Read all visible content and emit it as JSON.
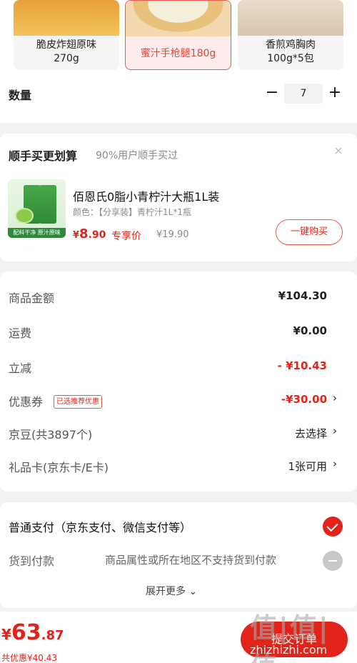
{
  "variants": [
    {
      "name_line1": "脆皮炸翅原味",
      "name_line2": "270g",
      "selected": false
    },
    {
      "name_line1": "蜜汁手枪腿180g",
      "name_line2": "",
      "selected": true
    },
    {
      "name_line1": "香煎鸡胸肉",
      "name_line2": "100g*5包",
      "selected": false
    }
  ],
  "quantity": {
    "label": "数量",
    "minus": "−",
    "value": "7",
    "plus": "+"
  },
  "addon": {
    "title": "顺手买更划算",
    "subtitle": "90%用户顺手买过",
    "close": "×",
    "image_tag": "配料干净 原汁原味",
    "name": "佰恩氏0脂小青柠汁大瓶1L装",
    "spec": "颜色：【分享装】青柠汁1L*1瓶",
    "price_symbol": "¥",
    "price_int": "8",
    "price_dec": ".90",
    "price_tag": "专享价",
    "original_price": "¥19.90",
    "buy_button": "一键购买"
  },
  "summary": {
    "rows": [
      {
        "label": "商品金额",
        "value": "¥104.30"
      },
      {
        "label": "运费",
        "value": "¥0.00"
      },
      {
        "label": "立减",
        "value": "- ¥10.43"
      },
      {
        "label": "优惠券",
        "badge": "已选推荐优惠",
        "value": "-¥30.00",
        "arrow": "›"
      },
      {
        "label": "京豆(共3897个)",
        "value": "去选择",
        "arrow": "›"
      },
      {
        "label": "礼品卡(京东卡/E卡)",
        "value": "1张可用",
        "arrow": "›"
      }
    ]
  },
  "payment": {
    "normal_label": "普通支付（京东支付、微信支付等）",
    "cod_label": "货到付款",
    "cod_note": "商品属性或所在地区不支持货到付款",
    "expand": "展开更多 ⌄"
  },
  "bottom": {
    "total_symbol": "¥",
    "total_int": "63",
    "total_dec": ".87",
    "saved": "共优惠¥40.43",
    "submit": "提交订单"
  },
  "watermark": {
    "text": "值|值|值",
    "url": "zhizhizhi.com"
  }
}
